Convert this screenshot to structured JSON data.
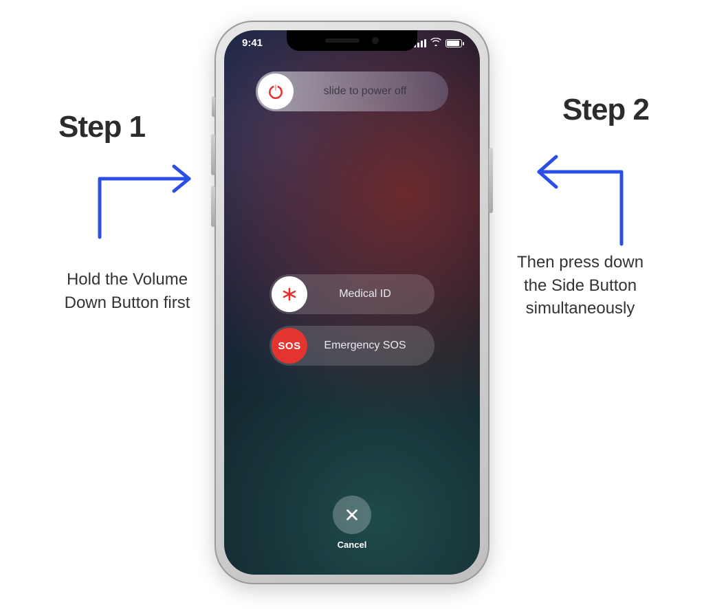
{
  "annotations": {
    "left": {
      "heading": "Step 1",
      "desc": "Hold the Volume Down Button first"
    },
    "right": {
      "heading": "Step 2",
      "desc": "Then press down the Side Button simultaneously"
    }
  },
  "status": {
    "time": "9:41"
  },
  "sliders": {
    "power": "slide to power off",
    "medical": "Medical ID",
    "sos_label": "Emergency SOS",
    "sos_knob": "SOS"
  },
  "cancel": "Cancel",
  "colors": {
    "arrow": "#2b4ee6",
    "danger": "#e3342f"
  }
}
